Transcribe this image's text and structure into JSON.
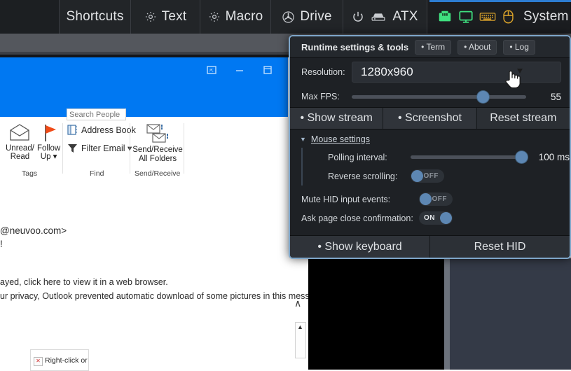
{
  "toolbar": {
    "items": [
      {
        "label": "",
        "icon": "",
        "name": "toolbar-empty-cell"
      },
      {
        "label": "Shortcuts",
        "icon": "",
        "name": "toolbar-shortcuts"
      },
      {
        "label": "Text",
        "icon": "gear-icon",
        "name": "toolbar-text"
      },
      {
        "label": "Macro",
        "icon": "gear-icon",
        "name": "toolbar-macro"
      },
      {
        "label": "Drive",
        "icon": "disc-icon",
        "name": "toolbar-drive"
      },
      {
        "label": "ATX",
        "icon": "power-icon,server-icon",
        "name": "toolbar-atx"
      },
      {
        "label": "System",
        "icon": "ethernet-icon,monitor-icon,keyboard-icon,mouse-icon",
        "name": "toolbar-system"
      }
    ],
    "system_icons": [
      "ethernet-icon",
      "monitor-icon",
      "keyboard-icon",
      "mouse-icon"
    ],
    "system_label": "System",
    "colors": {
      "bar_bg": "#222528",
      "ethernet": "#3fe07f",
      "monitor": "#3fe07f",
      "keyboard": "#d9a22a",
      "mouse": "#d9a22a",
      "accent_strip": "#2d7dd2"
    }
  },
  "panel": {
    "title": "Runtime settings & tools",
    "head_buttons": [
      {
        "label": "• Term",
        "name": "term-button"
      },
      {
        "label": "• About",
        "name": "about-button"
      },
      {
        "label": "• Log",
        "name": "log-button"
      }
    ],
    "resolution": {
      "label": "Resolution:",
      "value": "1280x960"
    },
    "max_fps": {
      "label": "Max FPS:",
      "value": "55",
      "percent": 77
    },
    "stream_buttons": [
      {
        "label": "• Show stream",
        "name": "show-stream-button"
      },
      {
        "label": "• Screenshot",
        "name": "screenshot-button"
      },
      {
        "label": "Reset stream",
        "name": "reset-stream-button"
      }
    ],
    "mouse_settings": {
      "section_label": "Mouse settings",
      "caret": "▼",
      "polling_interval": {
        "label": "Polling interval:",
        "value": "100 ms",
        "percent": 100
      },
      "reverse_scrolling": {
        "label": "Reverse scrolling:",
        "state": "OFF"
      }
    },
    "mute_hid": {
      "label": "Mute HID input events:",
      "state": "OFF"
    },
    "ask_close": {
      "label": "Ask page close confirmation:",
      "state": "ON"
    },
    "bottom_buttons": [
      {
        "label": "• Show keyboard",
        "name": "show-keyboard-button"
      },
      {
        "label": "Reset HID",
        "name": "reset-hid-button"
      }
    ],
    "colors": {
      "border": "#7ea6c9",
      "bg": "#1e2125",
      "knob": "#5d87b3"
    }
  },
  "outlook": {
    "title_bar_color": "#0078f2",
    "window_buttons": [
      "restore-icon",
      "minimize-icon",
      "maximize-icon"
    ],
    "ribbon": {
      "tags_group": {
        "label": "Tags",
        "items": [
          {
            "label1": "Unread/",
            "label2": "Read",
            "icon": "envelope-icon"
          },
          {
            "label1": "Follow",
            "label2": "Up ▾",
            "icon": "flag-icon"
          }
        ]
      },
      "find_group": {
        "label": "Find",
        "search_placeholder": "Search People",
        "items": [
          {
            "label": "Address Book",
            "icon": "address-book-icon"
          },
          {
            "label": "Filter Email ▾",
            "icon": "funnel-icon"
          }
        ]
      },
      "send_receive_group": {
        "label": "Send/Receive",
        "items": [
          {
            "label1": "Send/Receive",
            "label2": "All Folders",
            "icon": "send-receive-icon"
          }
        ]
      }
    },
    "message": {
      "sender_fragment": "@neuvoo.com>",
      "exclaim": "!",
      "line1": "ayed, click here to view it in a web browser.",
      "line2": "ur privacy, Outlook prevented automatic download of some pictures in this message.",
      "tooltip": "Right-click or"
    }
  }
}
